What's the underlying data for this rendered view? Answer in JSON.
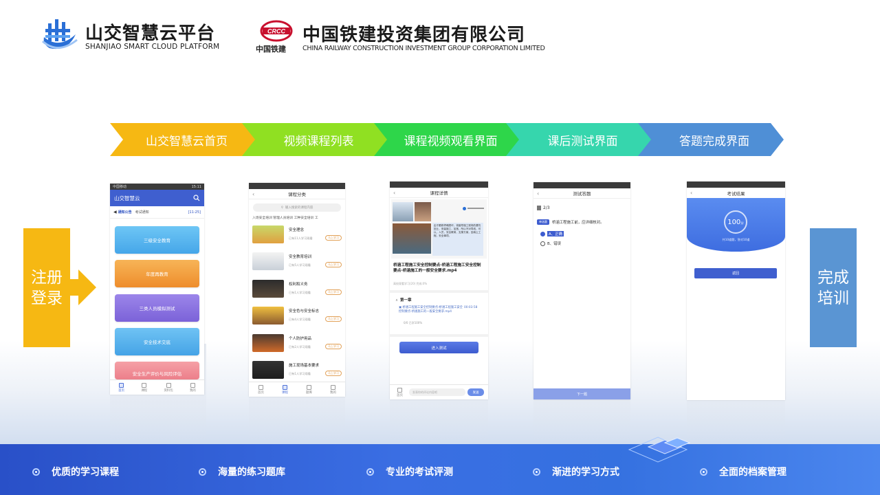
{
  "header": {
    "logo1_cn": "山交智慧云平台",
    "logo1_en": "SHANJIAO SMART CLOUD PLATFORM",
    "logo2_emblem": "中国铁建",
    "logo2_cn": "中国铁建投资集团有限公司",
    "logo2_en": "CHINA RAILWAY CONSTRUCTION INVESTMENT GROUP CORPORATION LIMITED"
  },
  "steps": [
    "山交智慧云首页",
    "视频课程列表",
    "课程视频观看界面",
    "课后测试界面",
    "答题完成界面"
  ],
  "step_colors": [
    "#f6b813",
    "#90e022",
    "#2ed64a",
    "#36d6ad",
    "#4f8fd6"
  ],
  "left_label": "注册\n登录",
  "right_label": "完成\n培训",
  "phone1": {
    "status_left": "中国移动",
    "status_right": "15:11",
    "title": "山交智慧云",
    "notice_tag": "通知公告",
    "notice_text": "考试通知",
    "notice_date": "[11-25]",
    "buttons": [
      "三级安全教育",
      "年度再教育",
      "三类人员模拟测试",
      "安全技术交底",
      "安全生产评价与风险评估"
    ],
    "tabs": [
      "首页",
      "课程",
      "资料包",
      "我的"
    ]
  },
  "phone2": {
    "title": "课程分类",
    "search_placeholder": "输入搜索的课程内容",
    "filters": "入场安全培训  管理人员培训  工种安全培训  工",
    "courses": [
      {
        "name": "安全理念",
        "meta": "已有11人学习观看",
        "btn": "马上学习"
      },
      {
        "name": "安全教育培训",
        "meta": "已有5人学习观看",
        "btn": "马上学习"
      },
      {
        "name": "权利和义务",
        "meta": "已有1人学习观看",
        "btn": "马上学习"
      },
      {
        "name": "安全色与安全标志",
        "meta": "已有4人学习观看",
        "btn": "马上学习"
      },
      {
        "name": "个人防护用品",
        "meta": "已有2人学习观看",
        "btn": "马上学习"
      },
      {
        "name": "施工现场基本要求",
        "meta": "已有1人学习观看",
        "btn": "马上学习"
      }
    ],
    "tabs": [
      "首页",
      "课程",
      "题库",
      "我的"
    ]
  },
  "phone3": {
    "title": "课程详情",
    "video_text": "由于跟修坍塌损坏，将普导施工现场的基坑回土，安装施工，加宽，所以不对导线，可以，人员，安全教育，支撑方案，回填土工程，安全事项。",
    "course_title": "桥涵工程施工安全控制要点-桥涵工程施工安全控制要点-桥涵施工的一般安全要求.mp4",
    "course_meta": "高校观看学习(20)   完成:0%",
    "chapter": "第一章",
    "lesson": "桥涵工程施工安全控制要点-桥涵工程施工安全控制要点-桥涵施工的一般安全要求.mp4",
    "lesson_time": "00:03:58",
    "lesson_progress": "0/0 已学100%",
    "enter_btn": "进入测试",
    "comment_placeholder": "发表你的评论内容吧",
    "send_btn": "发送",
    "home_label": "首页"
  },
  "phone4": {
    "title": "测试答题",
    "progress": "2/3",
    "qtype": "单选题",
    "question": "桥涵工程施工前，应详细核对。",
    "options": [
      "A、正确",
      "B、错误"
    ],
    "next_btn": "下一题"
  },
  "phone5": {
    "title": "考试结果",
    "score": "100",
    "score_unit": "分",
    "summary": "共10道题，答对10道",
    "back_btn": "返回"
  },
  "features": [
    "优质的学习课程",
    "海量的练习题库",
    "专业的考试评测",
    "渐进的学习方式",
    "全面的档案管理"
  ]
}
